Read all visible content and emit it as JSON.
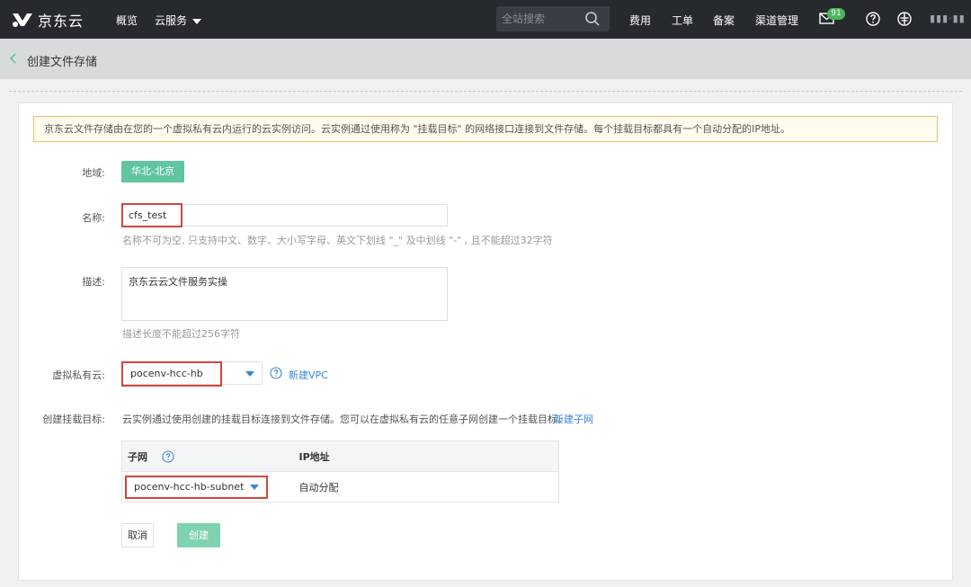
{
  "nav": {
    "logo_text": "京东云",
    "overview": "概览",
    "cloud_services": "云服务",
    "search_placeholder": "全站搜索",
    "billing": "费用",
    "tickets": "工单",
    "filing": "备案",
    "channel": "渠道管理",
    "mail_count": "91",
    "user": "▮▮▮·▮▮"
  },
  "subheader": {
    "title": "创建文件存储"
  },
  "form": {
    "notice": "京东云文件存储由在您的一个虚拟私有云内运行的云实例访问。云实例通过使用称为 \"挂载目标\" 的网络接口连接到文件存储。每个挂载目标都具有一个自动分配的IP地址。",
    "region_label": "地域:",
    "region_value": "华北-北京",
    "name_label": "名称:",
    "name_value": "cfs_test",
    "name_hint": "名称不可为空, 只支持中文、数字、大小写字母、英文下划线 \"_\" 及中划线 \"-\" , 且不能超过32字符",
    "desc_label": "描述:",
    "desc_value": "京东云云文件服务实操",
    "desc_hint": "描述长度不能超过256字符",
    "vpc_label": "虚拟私有云:",
    "vpc_value": "pocenv-hcc-hb",
    "new_vpc": "新建VPC",
    "mount_label": "创建挂载目标:",
    "mount_desc": "云实例通过使用创建的挂载目标连接到文件存储。您可以在虚拟私有云的任意子网创建一个挂载目标。",
    "new_subnet": "新建子网",
    "table": {
      "col_subnet": "子网",
      "col_ip": "IP地址",
      "subnet_value": "pocenv-hcc-hb-subnet",
      "ip_value": "自动分配"
    },
    "cancel": "取消",
    "create": "创建"
  },
  "colors": {
    "nav_bg": "#26292e",
    "accent_green": "#5fc6a0",
    "link_blue": "#3a86d6",
    "highlight_red": "#d6453c"
  }
}
